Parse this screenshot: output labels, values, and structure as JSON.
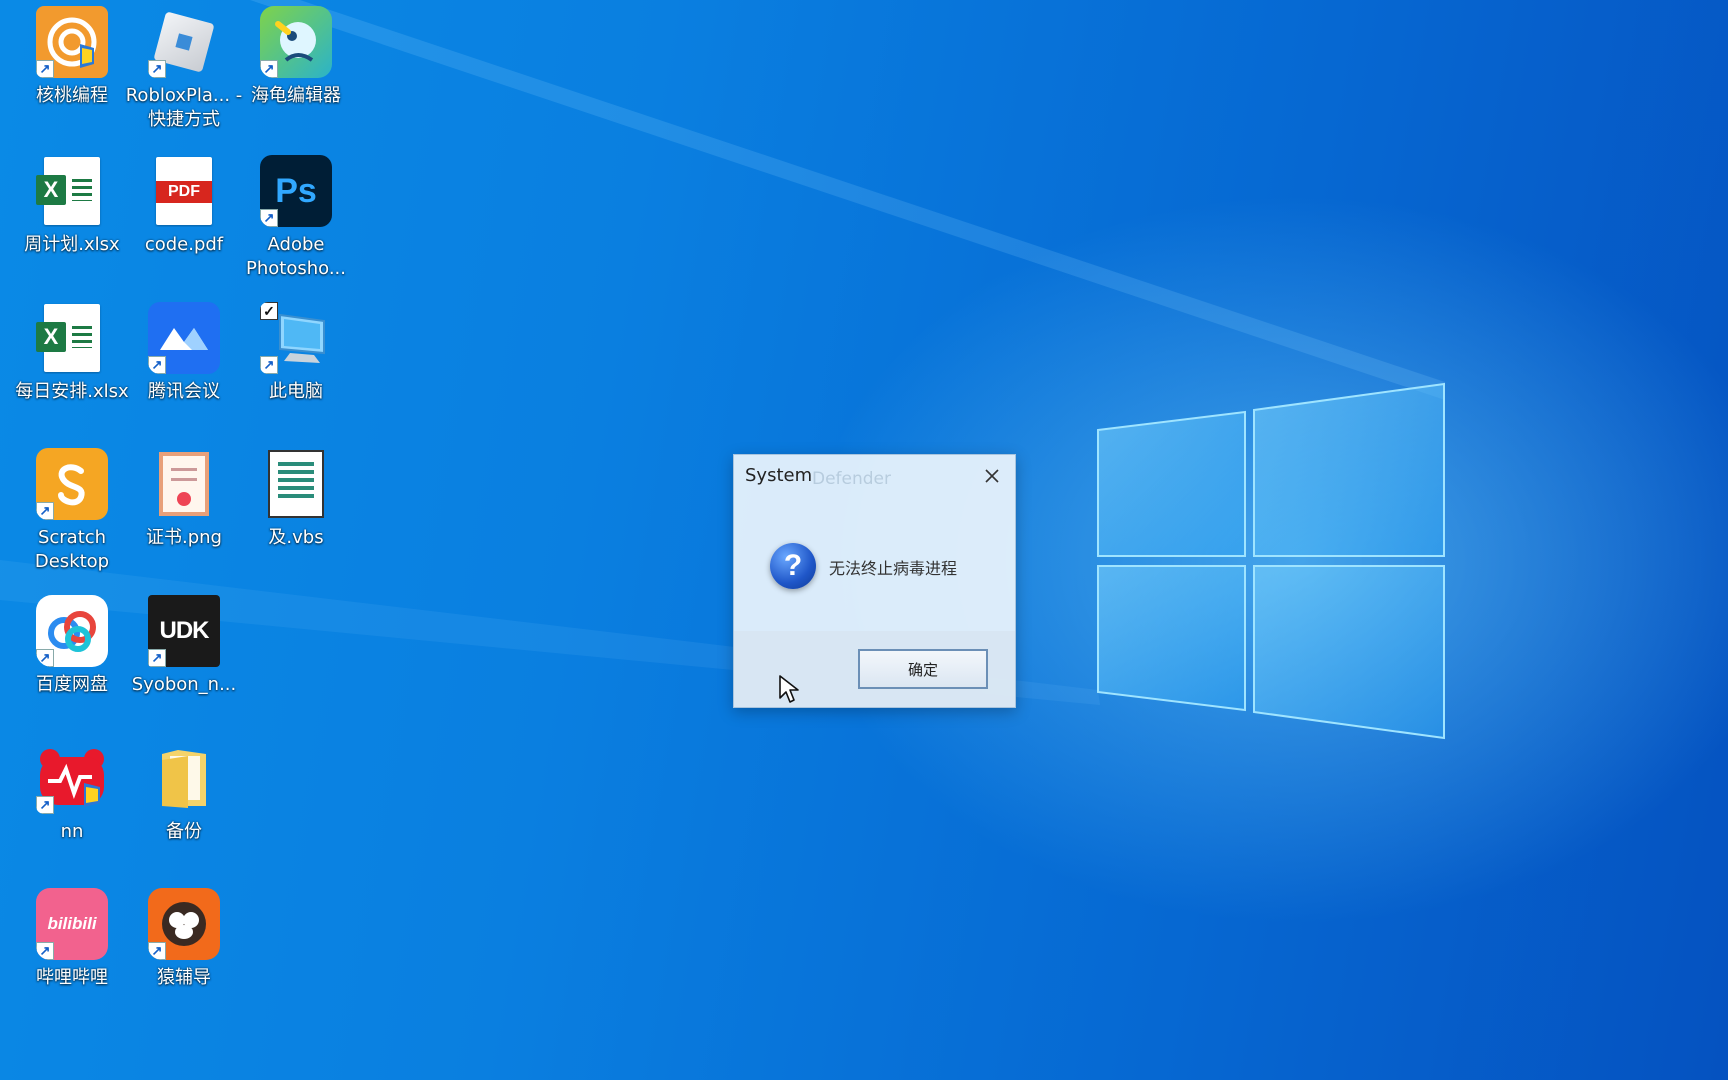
{
  "desktop": {
    "icons": [
      {
        "label": "核桃编程",
        "icon": "hetao-icon",
        "shortcut": true
      },
      {
        "label": "RobloxPla... - 快捷方式",
        "icon": "roblox-icon",
        "shortcut": true
      },
      {
        "label": "海龟编辑器",
        "icon": "turtle-editor-icon",
        "shortcut": true
      },
      {
        "label": "周计划.xlsx",
        "icon": "excel-file-icon",
        "shortcut": false
      },
      {
        "label": "code.pdf",
        "icon": "pdf-file-icon",
        "shortcut": false
      },
      {
        "label": "Adobe Photosho...",
        "icon": "photoshop-icon",
        "shortcut": true
      },
      {
        "label": "每日安排.xlsx",
        "icon": "excel-file-icon",
        "shortcut": false
      },
      {
        "label": "腾讯会议",
        "icon": "tencent-meeting-icon",
        "shortcut": true
      },
      {
        "label": "此电脑",
        "icon": "this-pc-icon",
        "shortcut": true
      },
      {
        "label": "Scratch Desktop",
        "icon": "scratch-icon",
        "shortcut": true
      },
      {
        "label": "证书.png",
        "icon": "certificate-image-icon",
        "shortcut": false
      },
      {
        "label": "及.vbs",
        "icon": "vbs-script-icon",
        "shortcut": false
      },
      {
        "label": "百度网盘",
        "icon": "baidu-netdisk-icon",
        "shortcut": true
      },
      {
        "label": "Syobon_n...",
        "icon": "udk-icon",
        "shortcut": true
      },
      {
        "label": "nn",
        "icon": "nn-accelerator-icon",
        "shortcut": true
      },
      {
        "label": "备份",
        "icon": "folder-icon",
        "shortcut": false
      },
      {
        "label": "哔哩哔哩",
        "icon": "bilibili-icon",
        "shortcut": true
      },
      {
        "label": "猿辅导",
        "icon": "yuanfudao-icon",
        "shortcut": true
      }
    ],
    "icon_text": {
      "ps": "Ps",
      "pdf": "PDF",
      "excel": "X",
      "udk": "UDK",
      "bili": "bilibili"
    }
  },
  "dialog": {
    "title": "System",
    "ghost_title": "Defender",
    "message": "无法终止病毒进程",
    "ok_label": "确定",
    "icon": "question-icon"
  },
  "colors": {
    "desktop_blue": "#0a7fe0",
    "dialog_bg": "#ebf4fc"
  }
}
